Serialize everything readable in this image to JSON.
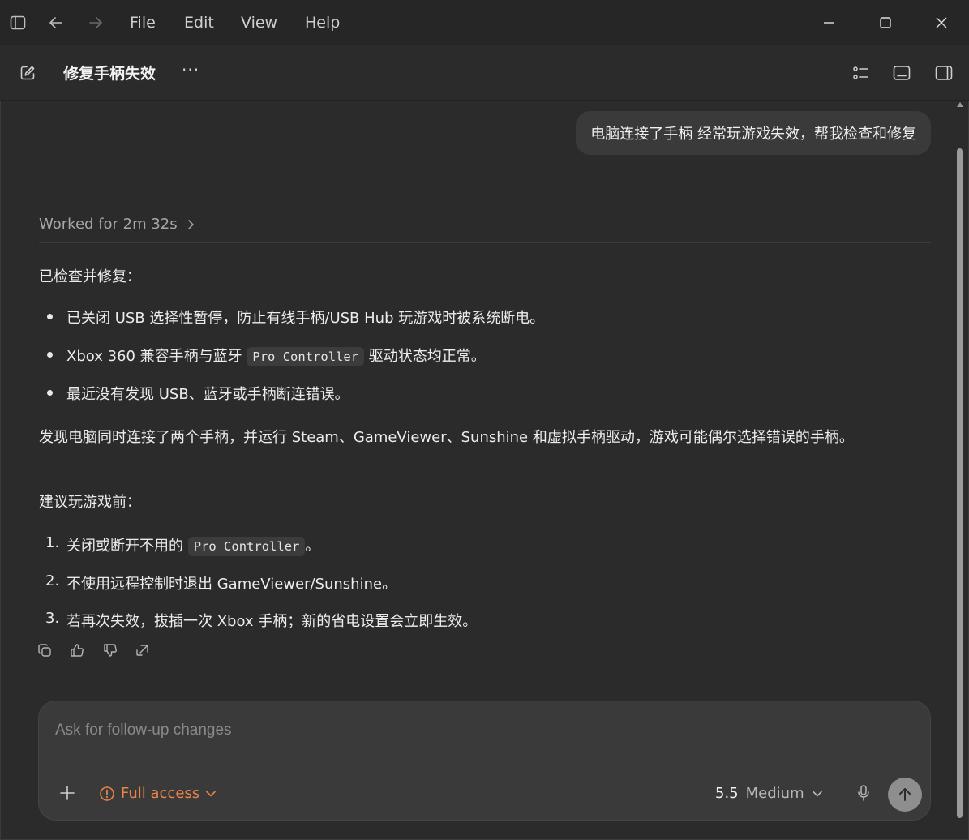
{
  "titlebar": {
    "menu": [
      "File",
      "Edit",
      "View",
      "Help"
    ],
    "icons": [
      "sidebar-toggle-icon",
      "back-arrow-icon",
      "forward-arrow-icon",
      "minimize-icon",
      "maximize-icon",
      "close-icon"
    ]
  },
  "header": {
    "title": "修复手柄失效",
    "more": "···"
  },
  "conversation": {
    "user_message": "电脑连接了手柄 经常玩游戏失效，帮我检查和修复",
    "worked_for": "Worked for 2m 32s",
    "intro": "已检查并修复：",
    "bullets": [
      {
        "pre": "已关闭 USB 选择性暂停，防止有线手柄/USB Hub 玩游戏时被系统断电。",
        "code": "",
        "post": ""
      },
      {
        "pre": "Xbox 360 兼容手柄与蓝牙 ",
        "code": "Pro Controller",
        "post": " 驱动状态均正常。"
      },
      {
        "pre": "最近没有发现 USB、蓝牙或手柄断连错误。",
        "code": "",
        "post": ""
      }
    ],
    "finding": "发现电脑同时连接了两个手柄，并运行 Steam、GameViewer、Sunshine 和虚拟手柄驱动，游戏可能偶尔选择错误的手柄。",
    "advice_title": "建议玩游戏前：",
    "steps": [
      {
        "num": "1.",
        "pre": "关闭或断开不用的 ",
        "code": "Pro Controller",
        "post": "。"
      },
      {
        "num": "2.",
        "pre": "不使用远程控制时退出 GameViewer/Sunshine。",
        "code": "",
        "post": ""
      },
      {
        "num": "3.",
        "pre": "若再次失效，拔插一次 Xbox 手柄；新的省电设置会立即生效。",
        "code": "",
        "post": ""
      }
    ]
  },
  "composer": {
    "placeholder": "Ask for follow-up changes",
    "access_label": "Full access",
    "model_version": "5.5",
    "model_effort": "Medium"
  },
  "colors": {
    "background": "#2b2b2b",
    "access_orange": "#e8834a",
    "send_button": "#8e8e8e"
  }
}
